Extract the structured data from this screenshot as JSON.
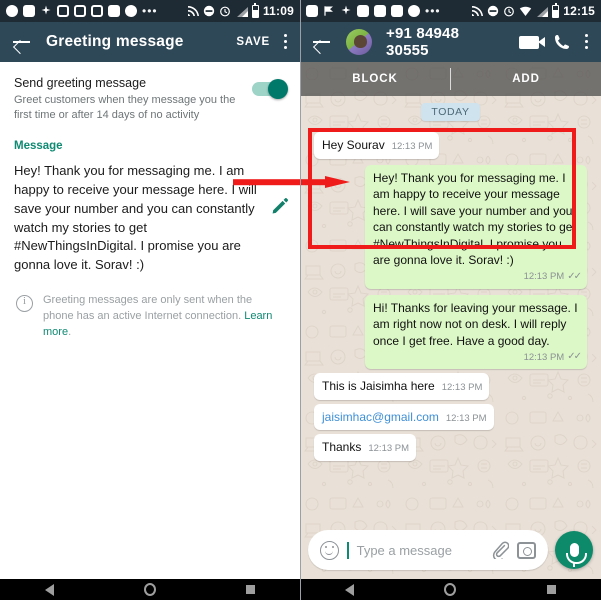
{
  "left": {
    "status_bar": {
      "time": "11:09",
      "icons": [
        "messenger-icon",
        "facebook-icon",
        "slack-icon",
        "instagram-icon",
        "instagram-icon",
        "instagram-icon",
        "linkedin-icon",
        "record-icon",
        "more-notifications-icon",
        "cast-icon",
        "dnd-icon",
        "alarm-icon",
        "signal-icon",
        "battery-icon"
      ]
    },
    "app_bar": {
      "back_label": "back",
      "title": "Greeting message",
      "save_label": "SAVE",
      "overflow_label": "more options"
    },
    "setting": {
      "title": "Send greeting message",
      "subtitle": "Greet customers when they message you the first time or after 14 days of no activity",
      "toggle_state": "on"
    },
    "message_section": {
      "label": "Message",
      "text": "Hey! Thank you for messaging me. I am happy to receive your message here. I will save your number and you can constantly watch my stories to get #NewThingsInDigital. I promise you are gonna love it. Sorav! :)",
      "edit_label": "edit"
    },
    "note": {
      "text": "Greeting messages are only sent when the phone has an active Internet connection. ",
      "link": "Learn more",
      "period": "."
    }
  },
  "right": {
    "status_bar": {
      "time": "12:15",
      "icons": [
        "news-icon",
        "flag-icon",
        "slack-icon",
        "linkedin-icon",
        "goodreads-icon",
        "linkedin-icon",
        "record-icon",
        "more-notifications-icon",
        "cast-icon",
        "dnd-icon",
        "alarm-icon",
        "wifi-icon",
        "signal-icon",
        "battery-icon"
      ]
    },
    "app_bar": {
      "back_label": "back",
      "contact": "+91 84948 30555",
      "video_call_label": "video call",
      "voice_call_label": "voice call",
      "overflow_label": "more options"
    },
    "unknown_contact_bar": {
      "block_label": "BLOCK",
      "add_label": "ADD"
    },
    "day_divider": "TODAY",
    "messages": [
      {
        "id": "m1",
        "direction": "in",
        "text": "Hey Sourav",
        "time": "12:13 PM",
        "inline": true,
        "status": ""
      },
      {
        "id": "m2",
        "direction": "out",
        "text": "Hey! Thank you for messaging me. I am happy to receive your message here. I will save your number and you can constantly watch my stories to get #NewThingsInDigital. I promise you are gonna love it. Sorav! :)",
        "time": "12:13 PM",
        "inline": false,
        "status": "read"
      },
      {
        "id": "m3",
        "direction": "out",
        "text": "Hi! Thanks for leaving your message. I am right now not on desk. I will reply once I get free. Have a good day.",
        "time": "12:13 PM",
        "inline": false,
        "status": "read"
      },
      {
        "id": "m4",
        "direction": "in",
        "text": "This is Jaisimha here",
        "time": "12:13 PM",
        "inline": true,
        "status": ""
      },
      {
        "id": "m5",
        "direction": "in",
        "text": "jaisimhac@gmail.com",
        "time": "12:13 PM",
        "inline": true,
        "status": "",
        "link": true
      },
      {
        "id": "m6",
        "direction": "in",
        "text": "Thanks",
        "time": "12:13 PM",
        "inline": true,
        "status": ""
      }
    ],
    "composer": {
      "placeholder": "Type a message",
      "emoji_label": "emoji",
      "attach_label": "attach",
      "camera_label": "camera",
      "mic_label": "voice message"
    }
  },
  "nav_bar": {
    "back_label": "back",
    "home_label": "home",
    "recents_label": "recents"
  },
  "annotation": {
    "highlight_color": "#ef1b1b",
    "arrow_color": "#ef1b1b"
  },
  "colors": {
    "app_bar": "#2f4858",
    "status_bar": "#1e2b34",
    "accent_teal": "#0f8a72",
    "outgoing_bubble": "#dcf8c6",
    "incoming_bubble": "#ffffff",
    "chat_background": "#e9e1d8"
  }
}
